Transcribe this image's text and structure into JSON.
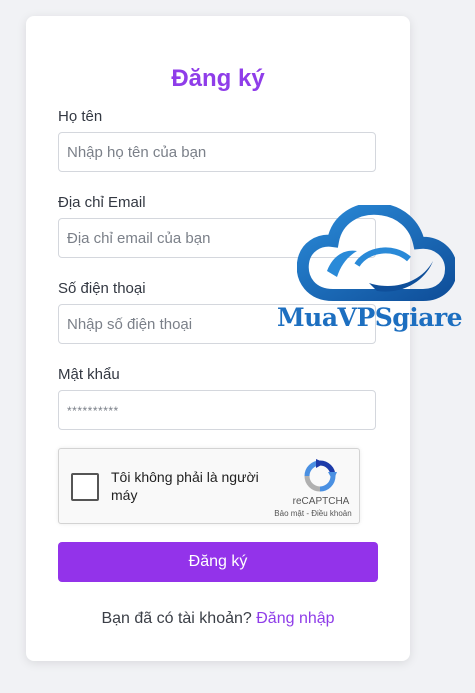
{
  "form": {
    "title": "Đăng ký",
    "fields": [
      {
        "label": "Họ tên",
        "placeholder": "Nhập họ tên của bạn",
        "value": ""
      },
      {
        "label": "Địa chỉ Email",
        "placeholder": "Địa chỉ email của bạn",
        "value": ""
      },
      {
        "label": "Số điện thoại",
        "placeholder": "Nhập số điện thoại",
        "value": ""
      },
      {
        "label": "Mật khẩu",
        "placeholder": "**********",
        "value": ""
      }
    ],
    "submit_label": "Đăng ký",
    "login_prompt": "Bạn đã có tài khoản?",
    "login_link": "Đăng nhập"
  },
  "recaptcha": {
    "checkbox_text": "Tôi không phải là người máy",
    "brand": "reCAPTCHA",
    "privacy_link": "Bảo mật",
    "separator": " - ",
    "terms_link": "Điều khoản"
  },
  "watermark": {
    "text": "MuaVPSgiare"
  },
  "colors": {
    "accent": "#9333ea",
    "title": "#8f3de9",
    "page_background": "#f1f2f5",
    "watermark_blue": "#1d6fc0"
  }
}
